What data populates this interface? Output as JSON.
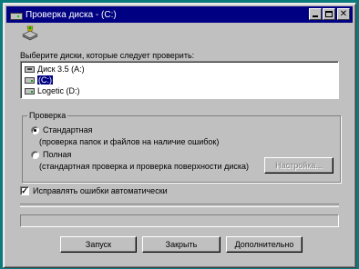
{
  "window": {
    "title": "Проверка диска - (C:)",
    "close_glyph": "✕"
  },
  "prompt": "Выберите диски, которые следует проверить:",
  "drives": [
    {
      "label": "Диск 3.5 (A:)",
      "icon": "floppy-drive-icon",
      "selected": false
    },
    {
      "label": "(C:)",
      "icon": "hard-drive-icon",
      "selected": true
    },
    {
      "label": "Logetic (D:)",
      "icon": "hard-drive-icon",
      "selected": false
    }
  ],
  "check_type": {
    "title": "Проверка",
    "standard": {
      "label": "Стандартная",
      "desc": "(проверка папок и файлов на наличие ошибок)",
      "selected": true
    },
    "full": {
      "label": "Полная",
      "desc": "(стандартная проверка и проверка поверхности диска)",
      "selected": false
    },
    "settings_button": "Настройка..."
  },
  "auto_fix": {
    "label": "Исправлять ошибки автоматически",
    "checked": true,
    "mark": "✓"
  },
  "buttons": {
    "start": "Запуск",
    "close": "Закрыть",
    "advanced": "Дополнительно"
  },
  "colors": {
    "titlebar": "#000082",
    "desktop": "#0a7a7c",
    "face": "#c0c0c0"
  }
}
